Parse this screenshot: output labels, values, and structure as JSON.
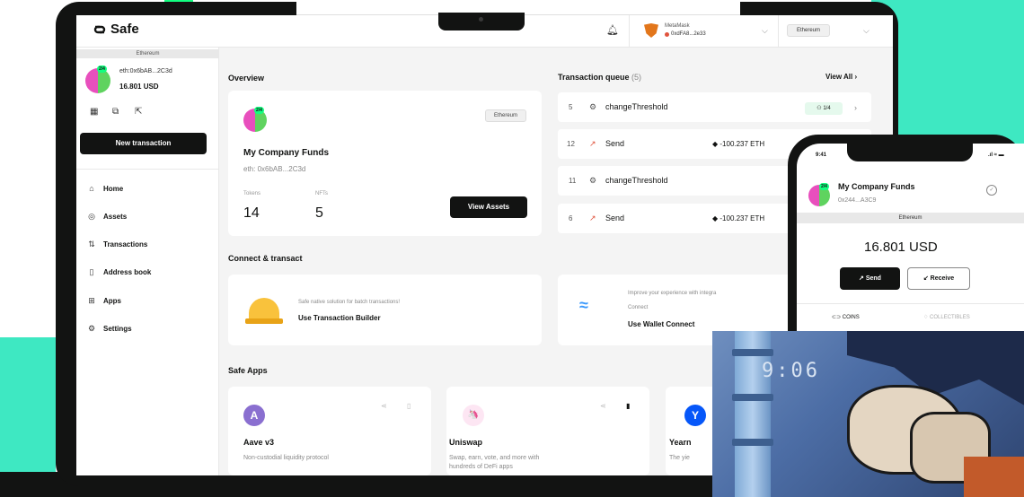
{
  "app": {
    "logo_text": "Safe",
    "network_label": "Ethereum"
  },
  "header": {
    "wallet_name": "MetaMask",
    "wallet_address": "0xdFA8...2e33",
    "network": "Ethereum"
  },
  "sidebar": {
    "network_banner": "Ethereum",
    "threshold": "2/4",
    "address": "eth:0x6bAB...2C3d",
    "balance": "16.801 USD",
    "new_tx_label": "New transaction",
    "nav": [
      {
        "label": "Home",
        "icon": "home-icon",
        "glyph": "⌂"
      },
      {
        "label": "Assets",
        "icon": "assets-icon",
        "glyph": "◎"
      },
      {
        "label": "Transactions",
        "icon": "transactions-icon",
        "glyph": "⇅"
      },
      {
        "label": "Address book",
        "icon": "address-book-icon",
        "glyph": "▯"
      },
      {
        "label": "Apps",
        "icon": "apps-icon",
        "glyph": "⊞"
      },
      {
        "label": "Settings",
        "icon": "settings-icon",
        "glyph": "⚙"
      }
    ]
  },
  "overview": {
    "title": "Overview",
    "network_chip": "Ethereum",
    "threshold": "2/4",
    "safe_name": "My Company Funds",
    "address": "eth: 0x6bAB...2C3d",
    "tokens_label": "Tokens",
    "tokens_value": "14",
    "nfts_label": "NFTs",
    "nfts_value": "5",
    "view_assets_label": "View Assets"
  },
  "queue": {
    "title": "Transaction queue",
    "count": "(5)",
    "view_all_label": "View All",
    "confirmations": "1/4",
    "rows": [
      {
        "nonce": "5",
        "icon": "⚙",
        "label": "changeThreshold",
        "amount": ""
      },
      {
        "nonce": "12",
        "icon": "↗",
        "label": "Send",
        "amount": "-100.237 ETH"
      },
      {
        "nonce": "11",
        "icon": "⚙",
        "label": "changeThreshold",
        "amount": ""
      },
      {
        "nonce": "6",
        "icon": "↗",
        "label": "Send",
        "amount": "-100.237 ETH"
      }
    ]
  },
  "connect": {
    "title": "Connect & transact",
    "builder_desc": "Safe native solution for batch transactions!",
    "builder_link": "Use Transaction Builder",
    "wc_desc_line1": "Improve your experience with integra",
    "wc_desc_line2": "Connect",
    "wc_link": "Use Wallet Connect"
  },
  "safe_apps": {
    "title": "Safe Apps",
    "apps": [
      {
        "name": "Aave v3",
        "desc": "Non-custodial liquidity protocol",
        "desc2": "",
        "logo": "A",
        "color": "#8a6fd0"
      },
      {
        "name": "Uniswap",
        "desc": "Swap, earn, vote, and more with",
        "desc2": "hundreds of DeFi apps",
        "logo": "🦄",
        "color": "#fde6f3"
      },
      {
        "name": "Yearn",
        "desc": "The yie",
        "desc2": "",
        "logo": "Y",
        "color": "#0657f9"
      }
    ]
  },
  "phone": {
    "time": "9:41",
    "status": ".ıl ≈ ▬",
    "threshold": "2/4",
    "safe_name": "My Company Funds",
    "address": "0x244...A3C9",
    "network": "Ethereum",
    "balance": "16.801 USD",
    "send_label": "↗ Send",
    "receive_label": "↙ Receive",
    "tab_coins": "COINS",
    "tab_collectibles": "COLLECTIBLES"
  },
  "video": {
    "timer": "9:06"
  },
  "colors": {
    "accent_green": "#12ff80",
    "teal_background": "#3ee8c2",
    "dark": "#121312"
  }
}
